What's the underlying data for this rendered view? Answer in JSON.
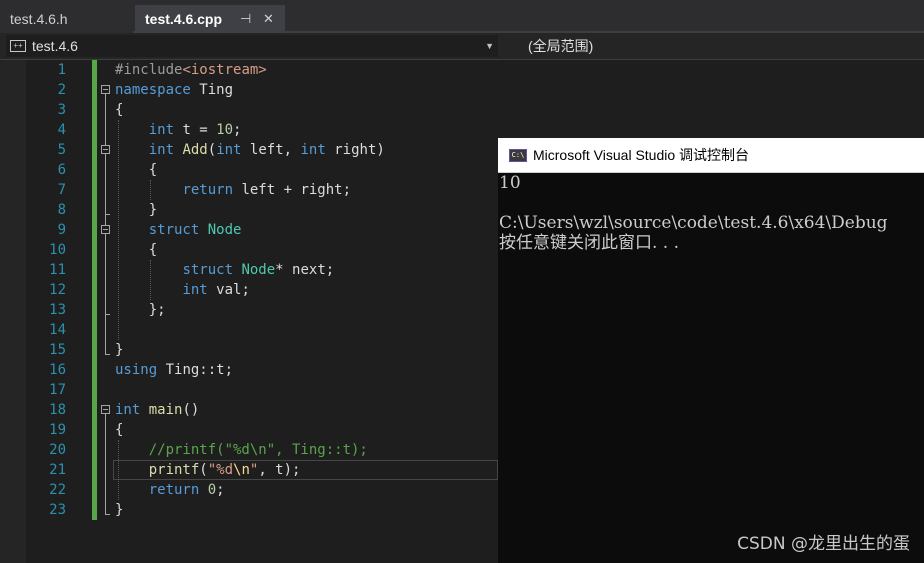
{
  "tabs": [
    {
      "label": "test.4.6.h",
      "active": false
    },
    {
      "label": "test.4.6.cpp",
      "active": true,
      "pin_icon": "⊣",
      "close_icon": "✕"
    }
  ],
  "navbar": {
    "project": "test.4.6",
    "scope": "(全局范围)"
  },
  "editor": {
    "current_line": 21,
    "lines": [
      {
        "n": "1",
        "segs": [
          [
            "pp",
            "#include"
          ],
          [
            "inc",
            "<iostream>"
          ]
        ]
      },
      {
        "n": "2",
        "segs": [
          [
            "kw",
            "namespace"
          ],
          [
            "br",
            " Ting"
          ]
        ]
      },
      {
        "n": "3",
        "segs": [
          [
            "br",
            "{"
          ]
        ]
      },
      {
        "n": "4",
        "segs": [
          [
            "br",
            "    "
          ],
          [
            "kw",
            "int"
          ],
          [
            "br",
            " t = "
          ],
          [
            "num",
            "10"
          ],
          [
            "br",
            ";"
          ]
        ]
      },
      {
        "n": "5",
        "segs": [
          [
            "br",
            "    "
          ],
          [
            "kw",
            "int"
          ],
          [
            "br",
            " "
          ],
          [
            "fn",
            "Add"
          ],
          [
            "br",
            "("
          ],
          [
            "kw",
            "int"
          ],
          [
            "br",
            " left, "
          ],
          [
            "kw",
            "int"
          ],
          [
            "br",
            " right)"
          ]
        ]
      },
      {
        "n": "6",
        "segs": [
          [
            "br",
            "    {"
          ]
        ]
      },
      {
        "n": "7",
        "segs": [
          [
            "br",
            "        "
          ],
          [
            "kw",
            "return"
          ],
          [
            "br",
            " left + right;"
          ]
        ]
      },
      {
        "n": "8",
        "segs": [
          [
            "br",
            "    }"
          ]
        ]
      },
      {
        "n": "9",
        "segs": [
          [
            "br",
            "    "
          ],
          [
            "kw",
            "struct"
          ],
          [
            "br",
            " "
          ],
          [
            "ty",
            "Node"
          ]
        ]
      },
      {
        "n": "10",
        "segs": [
          [
            "br",
            "    {"
          ]
        ]
      },
      {
        "n": "11",
        "segs": [
          [
            "br",
            "        "
          ],
          [
            "kw",
            "struct"
          ],
          [
            "br",
            " "
          ],
          [
            "ty",
            "Node"
          ],
          [
            "br",
            "* next;"
          ]
        ]
      },
      {
        "n": "12",
        "segs": [
          [
            "br",
            "        "
          ],
          [
            "kw",
            "int"
          ],
          [
            "br",
            " val;"
          ]
        ]
      },
      {
        "n": "13",
        "segs": [
          [
            "br",
            "    };"
          ]
        ]
      },
      {
        "n": "14",
        "segs": []
      },
      {
        "n": "15",
        "segs": [
          [
            "br",
            "}"
          ]
        ]
      },
      {
        "n": "16",
        "segs": [
          [
            "kw",
            "using"
          ],
          [
            "br",
            " Ting::t;"
          ]
        ]
      },
      {
        "n": "17",
        "segs": []
      },
      {
        "n": "18",
        "segs": [
          [
            "kw",
            "int"
          ],
          [
            "br",
            " "
          ],
          [
            "fn",
            "main"
          ],
          [
            "br",
            "()"
          ]
        ]
      },
      {
        "n": "19",
        "segs": [
          [
            "br",
            "{"
          ]
        ]
      },
      {
        "n": "20",
        "segs": [
          [
            "br",
            "    "
          ],
          [
            "cm",
            "//printf(\"%d\\n\", Ting::t);"
          ]
        ]
      },
      {
        "n": "21",
        "segs": [
          [
            "br",
            "    "
          ],
          [
            "fn",
            "printf"
          ],
          [
            "br",
            "("
          ],
          [
            "str",
            "\"%d"
          ],
          [
            "esc",
            "\\n"
          ],
          [
            "str",
            "\""
          ],
          [
            "br",
            ", t);"
          ]
        ]
      },
      {
        "n": "22",
        "segs": [
          [
            "br",
            "    "
          ],
          [
            "kw",
            "return"
          ],
          [
            "br",
            " "
          ],
          [
            "num",
            "0"
          ],
          [
            "br",
            ";"
          ]
        ]
      },
      {
        "n": "23",
        "segs": [
          [
            "br",
            "}"
          ]
        ]
      }
    ]
  },
  "console": {
    "title": "Microsoft Visual Studio 调试控制台",
    "icon_text": "C:\\",
    "output": [
      "10",
      "",
      "C:\\Users\\wzl\\source\\code\\test.4.6\\x64\\Debug",
      "按任意键关闭此窗口. . ."
    ]
  },
  "watermark": "CSDN @龙里出生的蛋"
}
